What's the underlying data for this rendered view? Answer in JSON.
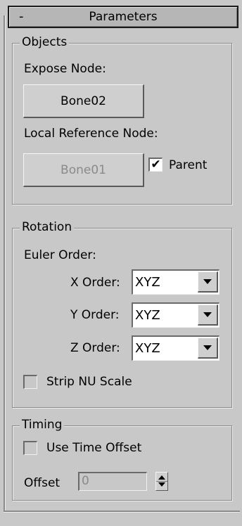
{
  "rollout": {
    "collapse_symbol": "-",
    "title": "Parameters"
  },
  "objects": {
    "legend": "Objects",
    "expose_node_label": "Expose Node:",
    "expose_node_button": "Bone02",
    "local_ref_label": "Local Reference Node:",
    "local_ref_button": "Bone01",
    "parent_label": "Parent",
    "parent_checked": true
  },
  "rotation": {
    "legend": "Rotation",
    "euler_label": "Euler Order:",
    "x_label": "X Order:",
    "x_value": "XYZ",
    "y_label": "Y Order:",
    "y_value": "XYZ",
    "z_label": "Z Order:",
    "z_value": "XYZ",
    "strip_label": "Strip NU Scale",
    "strip_checked": false
  },
  "timing": {
    "legend": "Timing",
    "use_offset_label": "Use Time Offset",
    "use_offset_checked": false,
    "offset_label": "Offset",
    "offset_value": "0"
  }
}
